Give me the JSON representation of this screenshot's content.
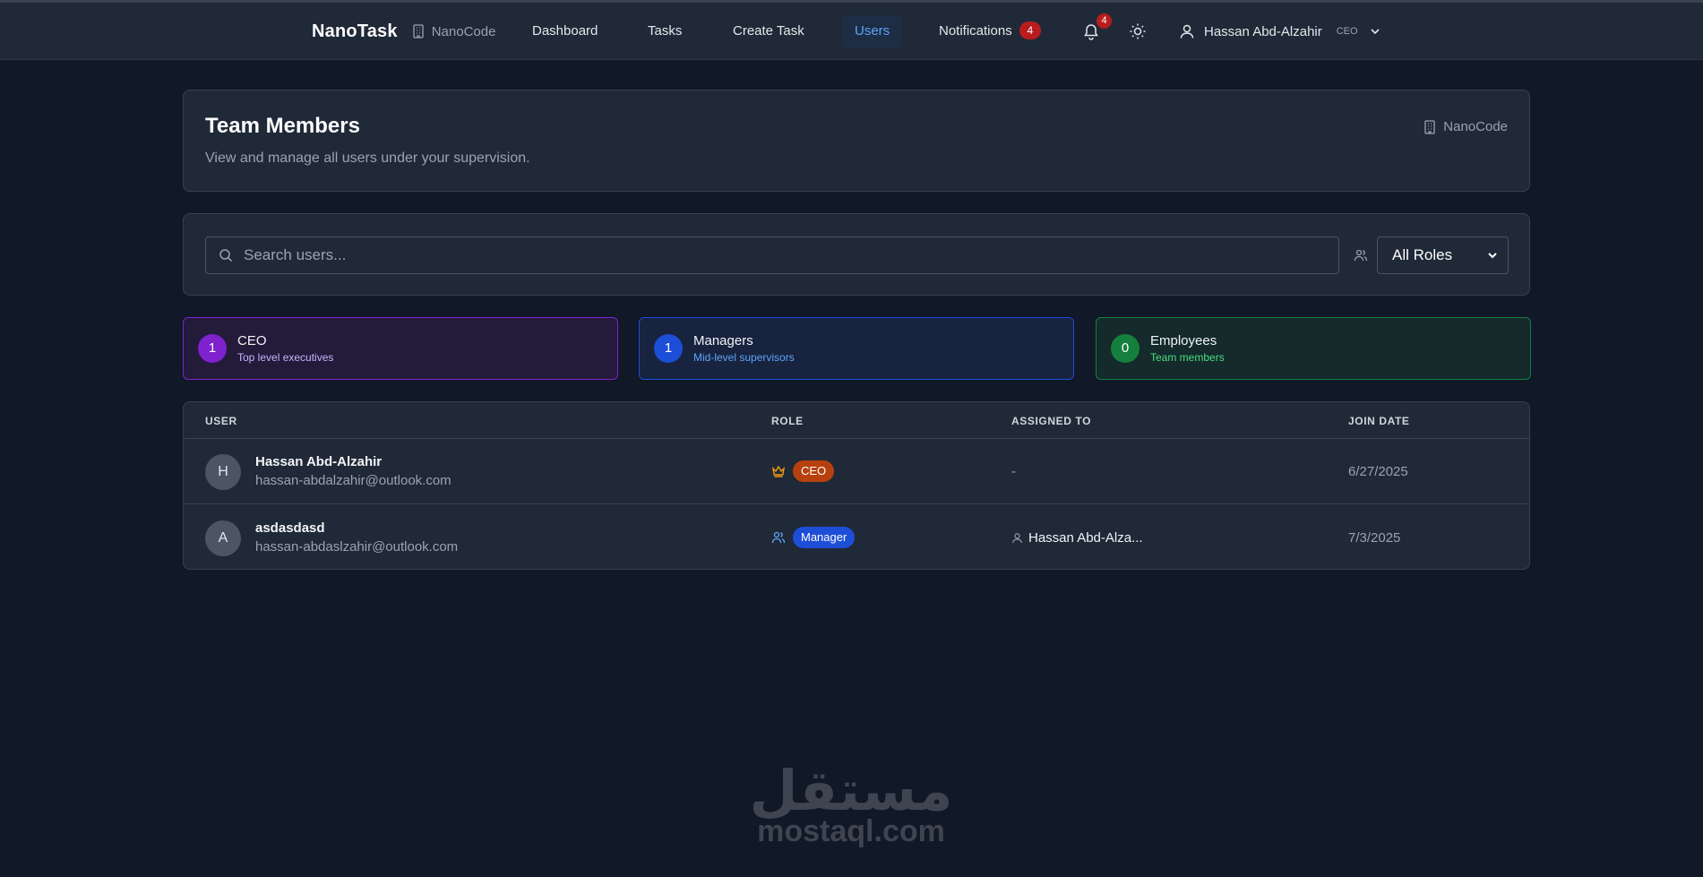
{
  "navbar": {
    "brand": "NanoTask",
    "org": "NanoCode",
    "links": [
      {
        "label": "Dashboard"
      },
      {
        "label": "Tasks"
      },
      {
        "label": "Create Task"
      },
      {
        "label": "Users"
      },
      {
        "label": "Notifications",
        "badge": "4"
      }
    ],
    "bell_badge": "4",
    "user_name": "Hassan Abd-Alzahir",
    "user_role": "CEO"
  },
  "header": {
    "title": "Team Members",
    "subtitle": "View and manage all users under your supervision.",
    "org": "NanoCode"
  },
  "filters": {
    "search_placeholder": "Search users...",
    "role_selected": "All Roles"
  },
  "stats": [
    {
      "count": "1",
      "title": "CEO",
      "desc": "Top level executives"
    },
    {
      "count": "1",
      "title": "Managers",
      "desc": "Mid-level supervisors"
    },
    {
      "count": "0",
      "title": "Employees",
      "desc": "Team members"
    }
  ],
  "table": {
    "headers": [
      "USER",
      "ROLE",
      "ASSIGNED TO",
      "JOIN DATE"
    ],
    "rows": [
      {
        "initial": "H",
        "name": "Hassan Abd-Alzahir",
        "email": "hassan-abdalzahir@outlook.com",
        "role": "CEO",
        "assigned_to": "-",
        "join_date": "6/27/2025"
      },
      {
        "initial": "A",
        "name": "asdasdasd",
        "email": "hassan-abdaslzahir@outlook.com",
        "role": "Manager",
        "assigned_to": "Hassan Abd-Alza...",
        "join_date": "7/3/2025"
      }
    ]
  },
  "watermark": {
    "arabic": "مستقل",
    "latin": "mostaql.com"
  },
  "colors": {
    "background": "#111827",
    "surface": "#1f2937",
    "accent": "#60a5fa",
    "ceo": "#7e22ce",
    "manager": "#1d4ed8",
    "employee": "#15803d",
    "alert": "#b91c1c"
  }
}
